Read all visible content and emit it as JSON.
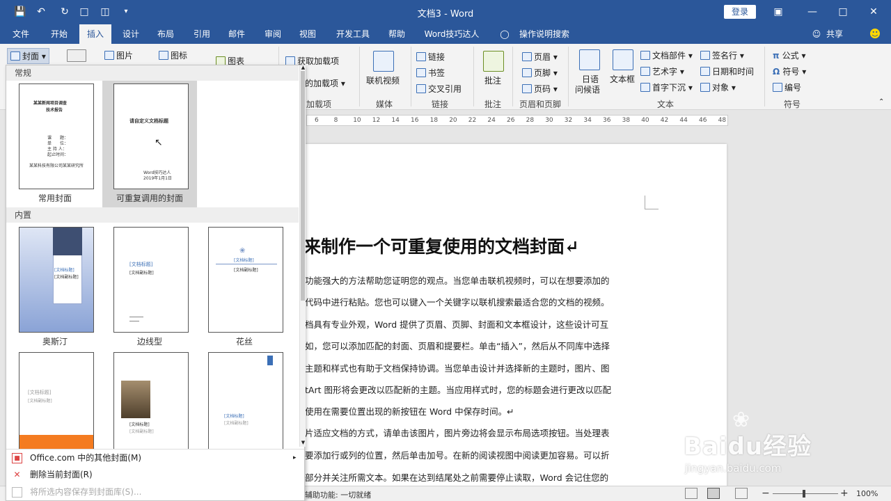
{
  "window": {
    "title": "文档3 - Word",
    "login": "登录"
  },
  "tabs": [
    "文件",
    "开始",
    "插入",
    "设计",
    "布局",
    "引用",
    "邮件",
    "审阅",
    "视图",
    "开发工具",
    "帮助",
    "Word技巧达人"
  ],
  "tell_me": "操作说明搜索",
  "share": "共享",
  "ribbon": {
    "cover_btn": "封面",
    "pictures": "图片",
    "icons": "图标",
    "chart": "图表",
    "get_addins": "获取加载项",
    "my_addins": "的加载项",
    "addins_group": "加载项",
    "online_video": "联机视频",
    "media_group": "媒体",
    "link": "链接",
    "bookmark": "书签",
    "crossref": "交叉引用",
    "links_group": "链接",
    "comment": "批注",
    "comment_group": "批注",
    "header": "页眉",
    "footer": "页脚",
    "pagenum": "页码",
    "hf_group": "页眉和页脚",
    "greet_line1": "日语",
    "greet_line2": "问候语",
    "textbox": "文本框",
    "quickparts": "文档部件",
    "wordart": "艺术字",
    "dropcap": "首字下沉",
    "sigline": "签名行",
    "datetime": "日期和时间",
    "object": "对象",
    "text_group": "文本",
    "equation": "公式",
    "symbol": "符号",
    "number": "编号",
    "symbols_group": "符号"
  },
  "ruler_numbers": [
    "6",
    "8",
    "10",
    "12",
    "14",
    "16",
    "18",
    "20",
    "22",
    "24",
    "26",
    "28",
    "30",
    "32",
    "34",
    "36",
    "38",
    "40",
    "42",
    "44",
    "46",
    "48"
  ],
  "gallery": {
    "section_regular": "常规",
    "section_builtin": "内置",
    "regular_items": [
      {
        "caption": "常用封面",
        "title1": "某某新闻项目调查",
        "title2": "技术报告",
        "lines": [
          "课　　题：",
          "单　　位：",
          "主 持 人：",
          "起止时间："
        ],
        "footer": "某某科技有限公司某某研究所"
      },
      {
        "caption": "可重复调用的封面",
        "title1": "请自定义文档标题",
        "footer1": "Word技巧达人",
        "footer2": "2019年1月1日"
      }
    ],
    "builtin_items": [
      {
        "caption": "奥斯汀",
        "title": "[文档标题]",
        "sub": "[文档副标题]"
      },
      {
        "caption": "边线型",
        "title": "[文档标题]",
        "sub": "[文档副标题]"
      },
      {
        "caption": "花丝",
        "title": "[文档标题]",
        "sub": "[文档副标题]"
      },
      {
        "caption": "",
        "title": "[文档标题]",
        "sub": "[文档副标题]"
      },
      {
        "caption": "",
        "title": "[文档标题]",
        "sub": "[文档副标题]"
      },
      {
        "caption": "",
        "title": "[文档标题]",
        "sub": "[文档副标题]"
      }
    ],
    "menu_more": "Office.com 中的其他封面(M)",
    "menu_delete": "删除当前封面(R)",
    "menu_save": "将所选内容保存到封面库(S)..."
  },
  "document": {
    "heading": "来制作一个可重复使用的文档封面↵",
    "lines": [
      "功能强大的方法帮助您证明您的观点。当您单击联机视频时，可以在想要添加的",
      "代码中进行粘贴。您也可以键入一个关键字以联机搜索最适合您的文档的视频。",
      "档具有专业外观，Word 提供了页眉、页脚、封面和文本框设计，这些设计可互",
      "如，您可以添加匹配的封面、页眉和提要栏。单击“插入”，然后从不同库中选择",
      "主题和样式也有助于文档保持协调。当您单击设计并选择新的主题时，图片、图",
      "tArt 图形将会更改以匹配新的主题。当应用样式时，您的标题会进行更改以匹配",
      "使用在需要位置出现的新按钮在 Word 中保存时间。↵",
      "片适应文档的方式，请单击该图片，图片旁边将会显示布局选项按钮。当处理表",
      "要添加行或列的位置，然后单击加号。在新的阅读视图中阅读更加容易。可以折",
      "部分并关注所需文本。如果在达到结尾处之前需要停止读取，Word 会记住您的"
    ]
  },
  "status": {
    "accessibility": "辅助功能: 一切就绪",
    "zoom": "100%"
  },
  "watermark": {
    "brand": "Baidu经验",
    "url": "jingyan.baidu.com"
  }
}
